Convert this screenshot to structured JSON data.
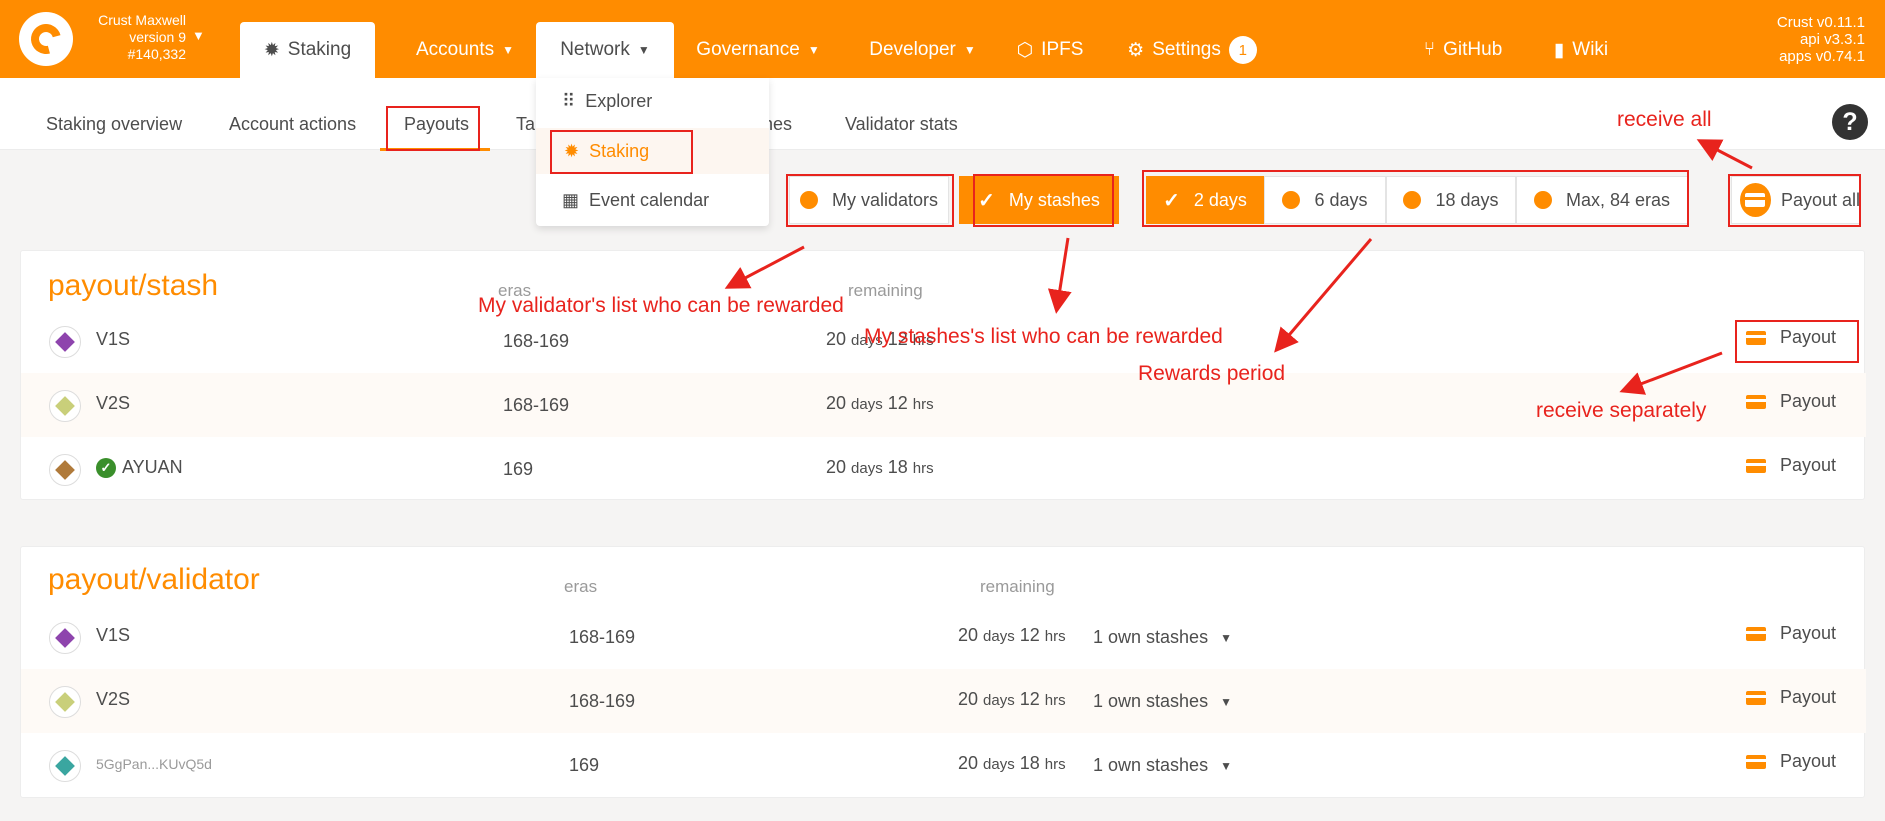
{
  "chain": {
    "name": "Crust Maxwell",
    "version": "version 9",
    "block": "#140,332"
  },
  "versions": {
    "client": "Crust v0.11.1",
    "api": "api v3.3.1",
    "apps": "apps v0.74.1"
  },
  "nav": {
    "staking": "Staking",
    "accounts": "Accounts",
    "network": "Network",
    "governance": "Governance",
    "developer": "Developer",
    "ipfs": "IPFS",
    "settings": "Settings",
    "settings_badge": "1",
    "github": "GitHub",
    "wiki": "Wiki"
  },
  "network_menu": {
    "explorer": "Explorer",
    "staking": "Staking",
    "event_calendar": "Event calendar"
  },
  "subtabs": {
    "overview": "Staking overview",
    "account_actions": "Account actions",
    "payouts": "Payouts",
    "targets_partial": "Ta",
    "slashes_partial": "nes",
    "validator_stats": "Validator stats"
  },
  "filters": {
    "my_validators": "My validators",
    "my_stashes": "My stashes",
    "days2": "2 days",
    "days6": "6 days",
    "days18": "18 days",
    "max": "Max, 84 eras",
    "payout_all": "Payout all"
  },
  "stash_table": {
    "title": "payout/stash",
    "col_eras": "eras",
    "col_remaining": "remaining",
    "rows": [
      {
        "name": "V1S",
        "eras": "168-169",
        "days": "20",
        "days_unit": "days",
        "hrs": "12",
        "hrs_unit": "hrs",
        "payout": "Payout"
      },
      {
        "name": "V2S",
        "eras": "168-169",
        "days": "20",
        "days_unit": "days",
        "hrs": "12",
        "hrs_unit": "hrs",
        "payout": "Payout"
      },
      {
        "name": "AYUAN",
        "eras": "169",
        "days": "20",
        "days_unit": "days",
        "hrs": "18",
        "hrs_unit": "hrs",
        "payout": "Payout"
      }
    ]
  },
  "validator_table": {
    "title": "payout/validator",
    "col_eras": "eras",
    "col_remaining": "remaining",
    "rows": [
      {
        "name": "V1S",
        "eras": "168-169",
        "days": "20",
        "days_unit": "days",
        "hrs": "12",
        "hrs_unit": "hrs",
        "own": "1 own stashes",
        "payout": "Payout"
      },
      {
        "name": "V2S",
        "eras": "168-169",
        "days": "20",
        "days_unit": "days",
        "hrs": "12",
        "hrs_unit": "hrs",
        "own": "1 own stashes",
        "payout": "Payout"
      },
      {
        "name": "5GgPan...KUvQ5d",
        "eras": "169",
        "days": "20",
        "days_unit": "days",
        "hrs": "18",
        "hrs_unit": "hrs",
        "own": "1 own stashes",
        "payout": "Payout"
      }
    ]
  },
  "annotations": {
    "receive_all": "receive all",
    "validators_list": "My validator's list who can be rewarded",
    "stashes_list": "My stashes's list who can be rewarded",
    "rewards_period": "Rewards period",
    "receive_separately": "receive separately"
  },
  "colors": {
    "brand": "#ff8c00",
    "annotation": "#e8231d"
  }
}
